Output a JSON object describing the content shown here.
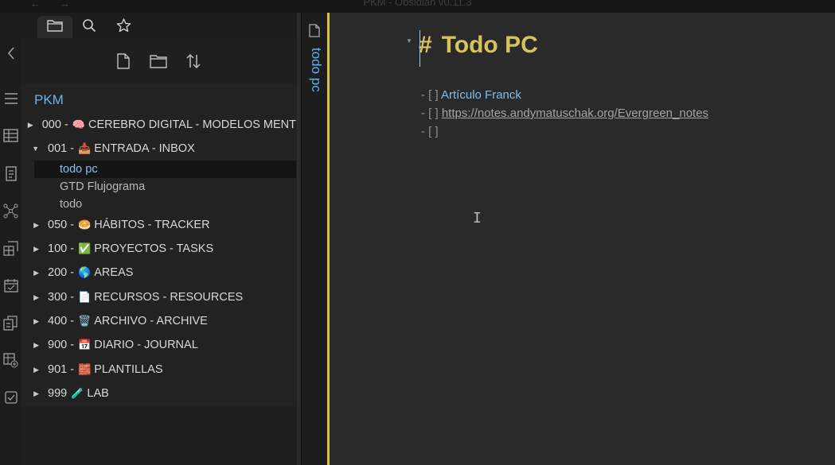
{
  "titlebar": {
    "title": "PKM - Obsidian v0.11.3",
    "back_glyph": "←",
    "forward_glyph": "→"
  },
  "ribbon": {
    "icons": [
      "chevron-left-icon",
      "menu-icon",
      "table-icon",
      "note-icon",
      "graph-icon",
      "grid-icon",
      "calendar-icon",
      "copy-icon",
      "table-plus-icon",
      "checkbox-icon"
    ]
  },
  "sidebar": {
    "tabs": [
      "files",
      "search",
      "starred"
    ],
    "tools": [
      "new-note",
      "new-folder",
      "sort"
    ],
    "vault": "PKM",
    "folders": [
      {
        "num": "000 -",
        "emoji": "🧠",
        "label": "CEREBRO DIGITAL - MODELOS MENT",
        "expanded": false
      },
      {
        "num": "001 -",
        "emoji": "📥",
        "label": "ENTRADA - INBOX",
        "expanded": true,
        "files": [
          "todo pc",
          "GTD Flujograma",
          "todo"
        ]
      },
      {
        "num": "050 -",
        "emoji": "🥯",
        "label": "HÁBITOS - TRACKER",
        "expanded": false
      },
      {
        "num": "100 -",
        "emoji": "✅",
        "label": "PROYECTOS - TASKS",
        "expanded": false
      },
      {
        "num": "200 -",
        "emoji": "🌎",
        "label": "AREAS",
        "expanded": false
      },
      {
        "num": "300 -",
        "emoji": "📄",
        "label": "RECURSOS - RESOURCES",
        "expanded": false
      },
      {
        "num": "400 -",
        "emoji": "🗑️",
        "label": "ARCHIVO - ARCHIVE",
        "expanded": false
      },
      {
        "num": "900 -",
        "emoji": "📅",
        "label": "DIARIO - JOURNAL",
        "expanded": false
      },
      {
        "num": "901 -",
        "emoji": "🧱",
        "label": "PLANTILLAS",
        "expanded": false
      },
      {
        "num": "999",
        "emoji": "🧪",
        "label": "LAB",
        "expanded": false
      }
    ],
    "active_file": "todo pc"
  },
  "pane": {
    "vertical_title": "todo pc"
  },
  "editor": {
    "heading_hash": "#",
    "heading": "Todo PC",
    "lines": [
      {
        "prefix": "- [ ]",
        "text": "Artículo Franck",
        "link": ""
      },
      {
        "prefix": "- [ ]",
        "text": "",
        "link": "https://notes.andymatuschak.org/Evergreen_notes"
      },
      {
        "prefix": "- [ ]",
        "text": "",
        "link": ""
      }
    ]
  },
  "colors": {
    "accent": "#d8c348",
    "link": "#7fbcee",
    "heading": "#d7c25c"
  }
}
